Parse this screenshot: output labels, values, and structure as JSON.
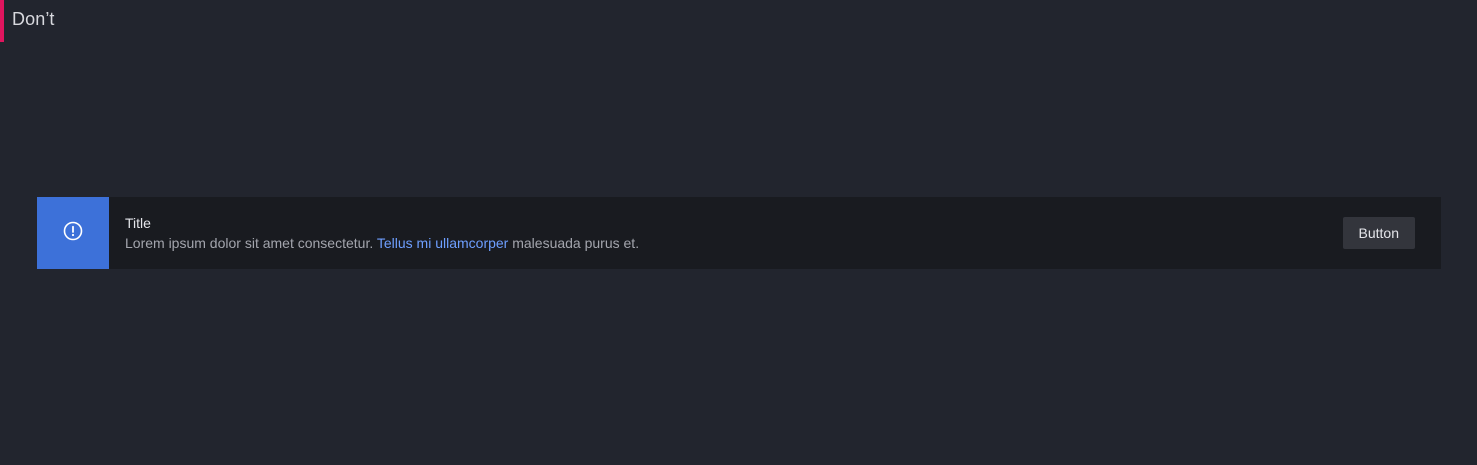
{
  "section": {
    "title": "Don’t",
    "accent_color": "#e0155e"
  },
  "alert": {
    "icon": "info-circle-icon",
    "icon_bg_color": "#3d71d9",
    "title": "Title",
    "description_before": "Lorem ipsum dolor sit amet consectetur. ",
    "link_text": "Tellus mi ullamcorper",
    "description_after": " malesuada purus et.",
    "link_color": "#6e9fff",
    "button_label": "Button"
  }
}
